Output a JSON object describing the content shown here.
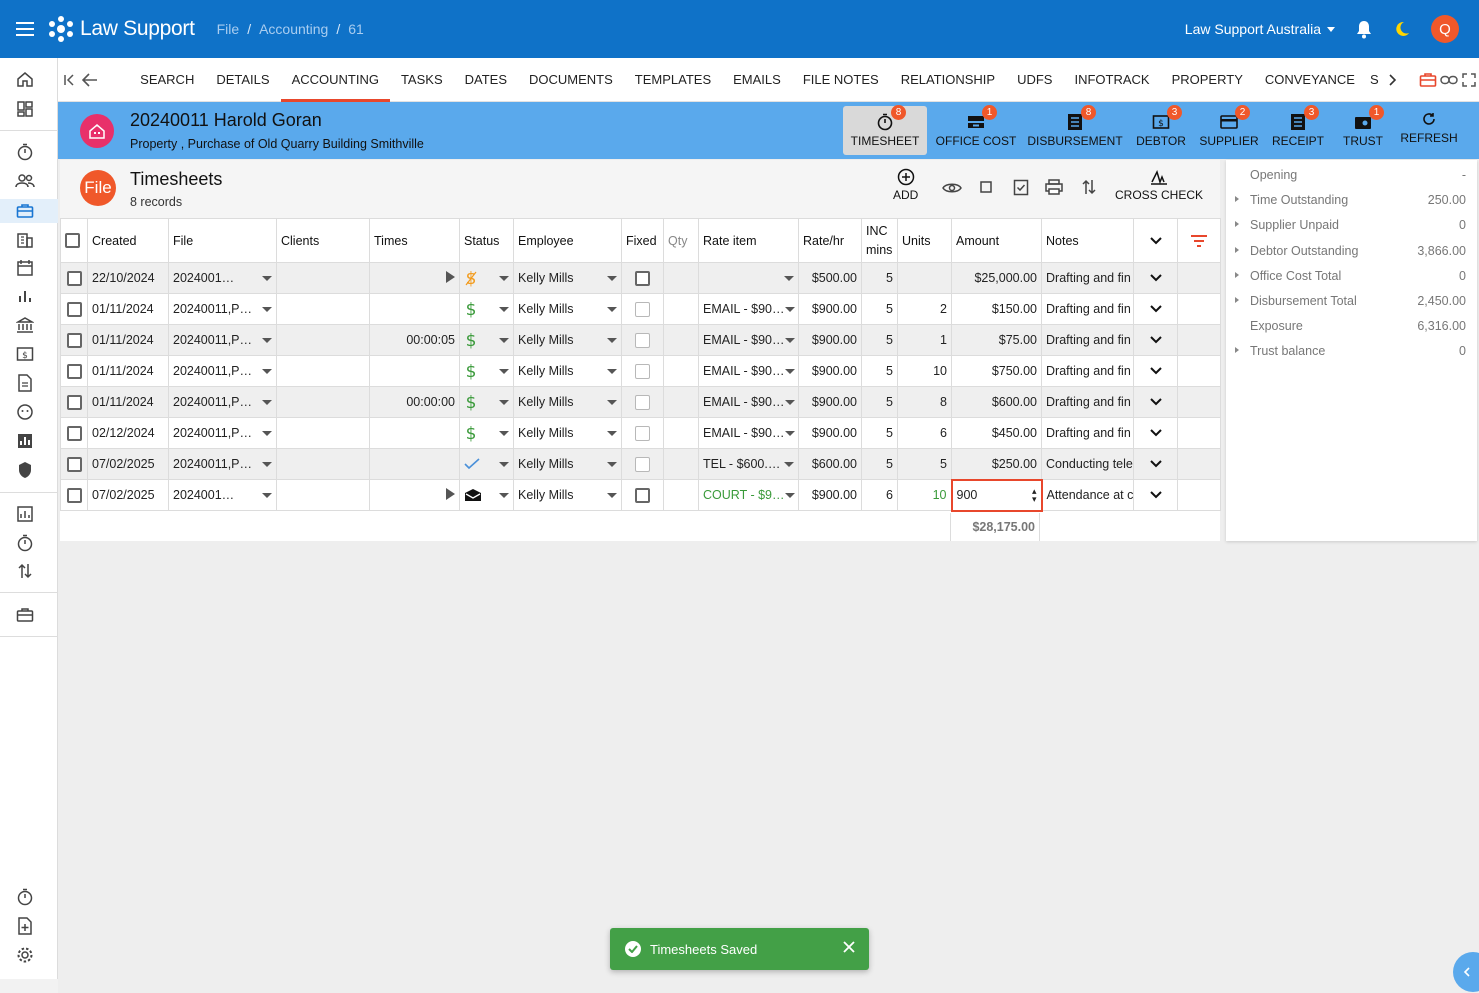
{
  "app": {
    "name": "Law Support",
    "breadcrumb": [
      "File",
      "Accounting",
      "61"
    ],
    "organisation": "Law Support Australia",
    "user_initial": "Q"
  },
  "tabs": [
    "SEARCH",
    "DETAILS",
    "ACCOUNTING",
    "TASKS",
    "DATES",
    "DOCUMENTS",
    "TEMPLATES",
    "EMAILS",
    "FILE NOTES",
    "RELATIONSHIP",
    "UDFS",
    "INFOTRACK",
    "PROPERTY",
    "CONVEYANCE",
    "S"
  ],
  "active_tab": "ACCOUNTING",
  "file": {
    "title": "20240011 Harold Goran",
    "subtitle": "Property , Purchase of Old Quarry Building Smithville"
  },
  "actions": [
    {
      "label": "TIMESHEET",
      "badge": "8"
    },
    {
      "label": "OFFICE COST",
      "badge": "1"
    },
    {
      "label": "DISBURSEMENT",
      "badge": "8"
    },
    {
      "label": "DEBTOR",
      "badge": "3"
    },
    {
      "label": "SUPPLIER",
      "badge": "2"
    },
    {
      "label": "RECEIPT",
      "badge": "3"
    },
    {
      "label": "TRUST",
      "badge": "1"
    },
    {
      "label": "REFRESH",
      "badge": ""
    }
  ],
  "timesheets": {
    "chip": "File",
    "title": "Timesheets",
    "count": "8 records",
    "add_label": "ADD",
    "cross_check_label": "CROSS CHECK",
    "columns": {
      "created": "Created",
      "file": "File",
      "clients": "Clients",
      "times": "Times",
      "status": "Status",
      "employee": "Employee",
      "fixed": "Fixed",
      "qty": "Qty",
      "rate_item": "Rate item",
      "rate_hr": "Rate/hr",
      "inc_mins": "INC mins",
      "units": "Units",
      "amount": "Amount",
      "notes": "Notes"
    },
    "rows": [
      {
        "created": "22/10/2024",
        "file": "2024001…",
        "times": "",
        "status": "dollar-pending",
        "employee": "Kelly Mills",
        "rate_item": "",
        "rate_hr": "$500.00",
        "inc": "5",
        "units": "",
        "amount": "$25,000.00",
        "notes": "Drafting and fin"
      },
      {
        "created": "01/11/2024",
        "file": "20240011,P…",
        "times": "",
        "status": "dollar",
        "employee": "Kelly Mills",
        "rate_item": "EMAIL - $90…",
        "rate_hr": "$900.00",
        "inc": "5",
        "units": "2",
        "amount": "$150.00",
        "notes": "Drafting and fin"
      },
      {
        "created": "01/11/2024",
        "file": "20240011,P…",
        "times": "00:00:05",
        "status": "dollar",
        "employee": "Kelly Mills",
        "rate_item": "EMAIL - $90…",
        "rate_hr": "$900.00",
        "inc": "5",
        "units": "1",
        "amount": "$75.00",
        "notes": "Drafting and fin"
      },
      {
        "created": "01/11/2024",
        "file": "20240011,P…",
        "times": "",
        "status": "dollar",
        "employee": "Kelly Mills",
        "rate_item": "EMAIL - $90…",
        "rate_hr": "$900.00",
        "inc": "5",
        "units": "10",
        "amount": "$750.00",
        "notes": "Drafting and fin"
      },
      {
        "created": "01/11/2024",
        "file": "20240011,P…",
        "times": "00:00:00",
        "status": "dollar",
        "employee": "Kelly Mills",
        "rate_item": "EMAIL - $90…",
        "rate_hr": "$900.00",
        "inc": "5",
        "units": "8",
        "amount": "$600.00",
        "notes": "Drafting and fin"
      },
      {
        "created": "02/12/2024",
        "file": "20240011,P…",
        "times": "",
        "status": "dollar",
        "employee": "Kelly Mills",
        "rate_item": "EMAIL - $90…",
        "rate_hr": "$900.00",
        "inc": "5",
        "units": "6",
        "amount": "$450.00",
        "notes": "Drafting and fin"
      },
      {
        "created": "07/02/2025",
        "file": "20240011,P…",
        "times": "",
        "status": "check",
        "employee": "Kelly Mills",
        "rate_item": "TEL - $600.…",
        "rate_hr": "$600.00",
        "inc": "5",
        "units": "5",
        "amount": "$250.00",
        "notes": "Conducting tele"
      },
      {
        "created": "07/02/2025",
        "file": "2024001…",
        "times": "",
        "status": "envelope",
        "employee": "Kelly Mills",
        "rate_item": "COURT - $9…",
        "rate_hr": "$900.00",
        "inc": "6",
        "units": "10",
        "amount": "900",
        "notes": "Attendance at c"
      }
    ],
    "total": "$28,175.00"
  },
  "summary": [
    {
      "label": "Opening",
      "value": "-",
      "expandable": false
    },
    {
      "label": "Time Outstanding",
      "value": "250.00",
      "expandable": true
    },
    {
      "label": "Supplier Unpaid",
      "value": "0",
      "expandable": true
    },
    {
      "label": "Debtor Outstanding",
      "value": "3,866.00",
      "expandable": true
    },
    {
      "label": "Office Cost Total",
      "value": "0",
      "expandable": true
    },
    {
      "label": "Disbursement Total",
      "value": "2,450.00",
      "expandable": true
    },
    {
      "label": "Exposure",
      "value": "6,316.00",
      "expandable": false
    },
    {
      "label": "Trust balance",
      "value": "0",
      "expandable": true
    }
  ],
  "toast": {
    "message": "Timesheets Saved"
  },
  "colors": {
    "topbar": "#0f72c8",
    "file_header": "#5aa9ec",
    "accent": "#f0582a",
    "success": "#43a047"
  }
}
